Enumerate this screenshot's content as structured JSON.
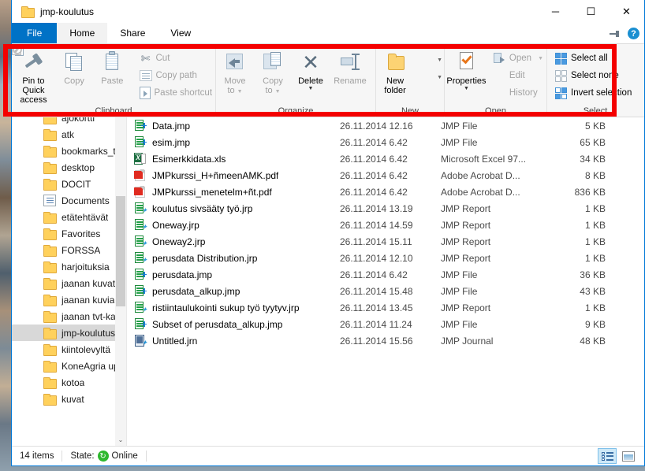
{
  "window": {
    "title": "jmp-koulutus",
    "minimize": "─",
    "maximize": "☐",
    "close": "✕"
  },
  "tabs": [
    {
      "label": "File",
      "type": "file"
    },
    {
      "label": "Home",
      "type": "active"
    },
    {
      "label": "Share",
      "type": "normal"
    },
    {
      "label": "View",
      "type": "normal"
    }
  ],
  "ribbon": {
    "pin_icon": "pin-ribbon-icon",
    "help_icon": "?",
    "groups": [
      {
        "title": "Clipboard",
        "big_buttons": [
          {
            "label": "Pin to Quick\naccess",
            "label_line1": "Pin to Quick",
            "label_line2": "access",
            "enabled": true
          },
          {
            "label": "Copy",
            "enabled": false
          },
          {
            "label": "Paste",
            "enabled": false
          }
        ],
        "small_buttons": [
          {
            "label": "Cut",
            "enabled": false
          },
          {
            "label": "Copy path",
            "enabled": false
          },
          {
            "label": "Paste shortcut",
            "enabled": false
          }
        ]
      },
      {
        "title": "Organize",
        "big_buttons": [
          {
            "label_line1": "Move",
            "label_line2": "to",
            "enabled": false,
            "dropdown": true
          },
          {
            "label_line1": "Copy",
            "label_line2": "to",
            "enabled": false,
            "dropdown": true
          },
          {
            "label": "Delete",
            "enabled": true,
            "dropdown": true
          },
          {
            "label": "Rename",
            "enabled": false
          }
        ]
      },
      {
        "title": "New",
        "big_buttons": [
          {
            "label_line1": "New",
            "label_line2": "folder",
            "enabled": true
          }
        ],
        "stacked_icons": [
          {
            "name": "new-item-icon"
          },
          {
            "name": "easy-access-icon"
          }
        ]
      },
      {
        "title": "Open",
        "big_buttons": [
          {
            "label": "Properties",
            "enabled": true,
            "dropdown": true
          }
        ],
        "small_buttons": [
          {
            "label": "Open",
            "enabled": false,
            "dropdown": true
          },
          {
            "label": "Edit",
            "enabled": false
          },
          {
            "label": "History",
            "enabled": false
          }
        ]
      },
      {
        "title": "Select",
        "small_buttons": [
          {
            "label": "Select all",
            "enabled": true
          },
          {
            "label": "Select none",
            "enabled": true
          },
          {
            "label": "Invert selection",
            "enabled": true
          }
        ]
      }
    ]
  },
  "navpane": {
    "items": [
      {
        "label": "ajokortti",
        "icon": "folder-icon",
        "selected": false,
        "partial": true
      },
      {
        "label": "atk",
        "icon": "folder-icon",
        "selected": false
      },
      {
        "label": "bookmarks_ter",
        "icon": "folder-icon",
        "selected": false
      },
      {
        "label": "desktop",
        "icon": "folder-icon",
        "selected": false
      },
      {
        "label": "DOCIT",
        "icon": "folder-icon",
        "selected": false
      },
      {
        "label": "Documents",
        "icon": "documents-icon",
        "selected": false
      },
      {
        "label": "etätehtävät",
        "icon": "folder-icon",
        "selected": false
      },
      {
        "label": "Favorites",
        "icon": "folder-icon",
        "selected": false
      },
      {
        "label": "FORSSA",
        "icon": "folder-icon",
        "selected": false
      },
      {
        "label": "harjoituksia",
        "icon": "folder-icon",
        "selected": false
      },
      {
        "label": "jaanan kuvat",
        "icon": "folder-icon",
        "selected": false
      },
      {
        "label": "jaanan kuvia",
        "icon": "folder-icon",
        "selected": false
      },
      {
        "label": "jaanan tvt-kans",
        "icon": "folder-icon",
        "selected": false
      },
      {
        "label": "jmp-koulutus",
        "icon": "folder-icon",
        "selected": true
      },
      {
        "label": "kiintolevyltä",
        "icon": "folder-icon",
        "selected": false
      },
      {
        "label": "KoneAgria upn",
        "icon": "folder-icon",
        "selected": false
      },
      {
        "label": "kotoa",
        "icon": "folder-icon",
        "selected": false
      },
      {
        "label": "kuvat",
        "icon": "folder-icon",
        "selected": false
      }
    ],
    "scroll_up": "▲",
    "scroll_down": "⌄"
  },
  "filelist": {
    "rows": [
      {
        "name": "Data.jmp",
        "date": "26.11.2014 12.16",
        "type": "JMP File",
        "size": "5 KB",
        "icon": "jmp"
      },
      {
        "name": "esim.jmp",
        "date": "26.11.2014 6.42",
        "type": "JMP File",
        "size": "65 KB",
        "icon": "jmp"
      },
      {
        "name": "Esimerkkidata.xls",
        "date": "26.11.2014 6.42",
        "type": "Microsoft Excel 97...",
        "size": "34 KB",
        "icon": "xls"
      },
      {
        "name": "JMPkurssi_H+ñmeenAMK.pdf",
        "date": "26.11.2014 6.42",
        "type": "Adobe Acrobat D...",
        "size": "8 KB",
        "icon": "pdf"
      },
      {
        "name": "JMPkurssi_menetelm+ñt.pdf",
        "date": "26.11.2014 6.42",
        "type": "Adobe Acrobat D...",
        "size": "836 KB",
        "icon": "pdf"
      },
      {
        "name": "koulutus sivsääty työ.jrp",
        "date": "26.11.2014 13.19",
        "type": "JMP Report",
        "size": "1 KB",
        "icon": "jrp"
      },
      {
        "name": "Oneway.jrp",
        "date": "26.11.2014 14.59",
        "type": "JMP Report",
        "size": "1 KB",
        "icon": "jrp"
      },
      {
        "name": "Oneway2.jrp",
        "date": "26.11.2014 15.11",
        "type": "JMP Report",
        "size": "1 KB",
        "icon": "jrp"
      },
      {
        "name": "perusdata Distribution.jrp",
        "date": "26.11.2014 12.10",
        "type": "JMP Report",
        "size": "1 KB",
        "icon": "jrp"
      },
      {
        "name": "perusdata.jmp",
        "date": "26.11.2014 6.42",
        "type": "JMP File",
        "size": "36 KB",
        "icon": "jmp"
      },
      {
        "name": "perusdata_alkup.jmp",
        "date": "26.11.2014 15.48",
        "type": "JMP File",
        "size": "43 KB",
        "icon": "jmp"
      },
      {
        "name": "ristiintaulukointi sukup työ tyytyv.jrp",
        "date": "26.11.2014 13.45",
        "type": "JMP Report",
        "size": "1 KB",
        "icon": "jrp"
      },
      {
        "name": "Subset of perusdata_alkup.jmp",
        "date": "26.11.2014 11.24",
        "type": "JMP File",
        "size": "9 KB",
        "icon": "jmp"
      },
      {
        "name": "Untitled.jrn",
        "date": "26.11.2014 15.56",
        "type": "JMP Journal",
        "size": "48 KB",
        "icon": "jrn"
      }
    ]
  },
  "statusbar": {
    "item_count": "14 items",
    "state_label": "State:",
    "state_value": "Online",
    "sync_icon": "↻",
    "view_details": "details-view-icon",
    "view_thumbnails": "large-icons-view-icon"
  },
  "annotation": {
    "color": "#f40000",
    "name": "red-highlight-rectangle"
  }
}
